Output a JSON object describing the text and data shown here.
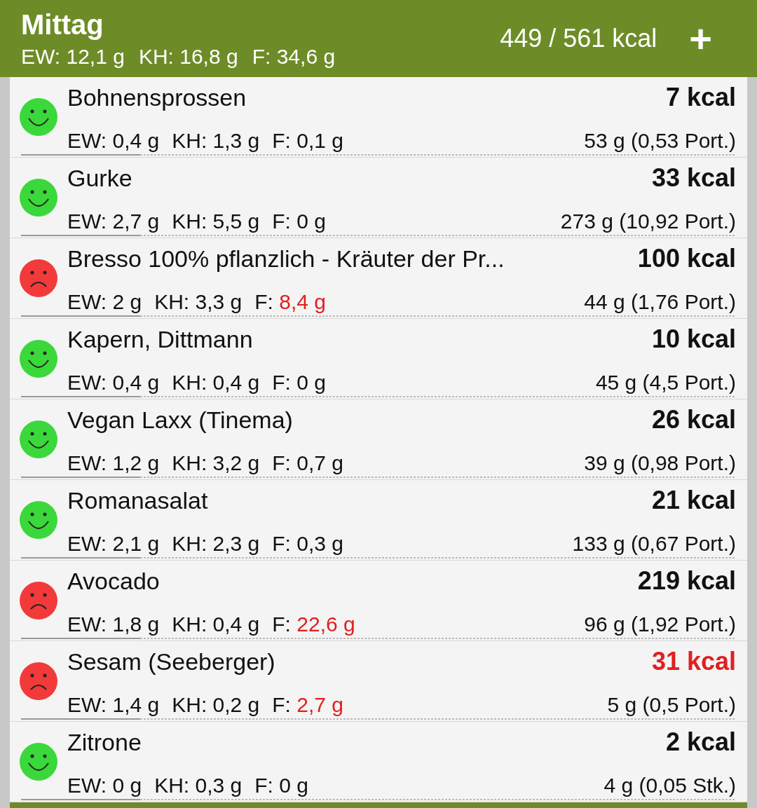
{
  "header": {
    "title": "Mittag",
    "macros": [
      {
        "label": "EW:",
        "value": "12,1 g"
      },
      {
        "label": "KH:",
        "value": "16,8 g"
      },
      {
        "label": "F:",
        "value": "34,6 g"
      }
    ],
    "total": "449 / 561 kcal",
    "add": "+"
  },
  "items": [
    {
      "name": "Bohnensprossen",
      "kind": "happy",
      "kcal": "7 kcal",
      "kcal_warning": false,
      "macros": [
        {
          "label": "EW:",
          "value": "0,4 g",
          "warning": false
        },
        {
          "label": "KH:",
          "value": "1,3 g",
          "warning": false
        },
        {
          "label": "F:",
          "value": "0,1 g",
          "warning": false
        }
      ],
      "amount": "53 g (0,53 Port.)"
    },
    {
      "name": "Gurke",
      "kind": "happy",
      "kcal": "33 kcal",
      "kcal_warning": false,
      "macros": [
        {
          "label": "EW:",
          "value": "2,7 g",
          "warning": false
        },
        {
          "label": "KH:",
          "value": "5,5 g",
          "warning": false
        },
        {
          "label": "F:",
          "value": "0 g",
          "warning": false
        }
      ],
      "amount": "273 g (10,92 Port.)"
    },
    {
      "name": "Bresso 100% pflanzlich - Kräuter der Pr...",
      "kind": "sad",
      "kcal": "100 kcal",
      "kcal_warning": false,
      "macros": [
        {
          "label": "EW:",
          "value": "2 g",
          "warning": false
        },
        {
          "label": "KH:",
          "value": "3,3 g",
          "warning": false
        },
        {
          "label": "F:",
          "value": "8,4 g",
          "warning": true
        }
      ],
      "amount": "44 g (1,76 Port.)"
    },
    {
      "name": "Kapern, Dittmann",
      "kind": "happy",
      "kcal": "10 kcal",
      "kcal_warning": false,
      "macros": [
        {
          "label": "EW:",
          "value": "0,4 g",
          "warning": false
        },
        {
          "label": "KH:",
          "value": "0,4 g",
          "warning": false
        },
        {
          "label": "F:",
          "value": "0 g",
          "warning": false
        }
      ],
      "amount": "45 g (4,5 Port.)"
    },
    {
      "name": "Vegan Laxx (Tinema)",
      "kind": "happy",
      "kcal": "26 kcal",
      "kcal_warning": false,
      "macros": [
        {
          "label": "EW:",
          "value": "1,2 g",
          "warning": false
        },
        {
          "label": "KH:",
          "value": "3,2 g",
          "warning": false
        },
        {
          "label": "F:",
          "value": "0,7 g",
          "warning": false
        }
      ],
      "amount": "39 g (0,98 Port.)"
    },
    {
      "name": "Romanasalat",
      "kind": "happy",
      "kcal": "21 kcal",
      "kcal_warning": false,
      "macros": [
        {
          "label": "EW:",
          "value": "2,1 g",
          "warning": false
        },
        {
          "label": "KH:",
          "value": "2,3 g",
          "warning": false
        },
        {
          "label": "F:",
          "value": "0,3 g",
          "warning": false
        }
      ],
      "amount": "133 g (0,67 Port.)"
    },
    {
      "name": "Avocado",
      "kind": "sad",
      "kcal": "219 kcal",
      "kcal_warning": false,
      "macros": [
        {
          "label": "EW:",
          "value": "1,8 g",
          "warning": false
        },
        {
          "label": "KH:",
          "value": "0,4 g",
          "warning": false
        },
        {
          "label": "F:",
          "value": "22,6 g",
          "warning": true
        }
      ],
      "amount": "96 g (1,92 Port.)"
    },
    {
      "name": "Sesam (Seeberger)",
      "kind": "sad",
      "kcal": "31 kcal",
      "kcal_warning": true,
      "macros": [
        {
          "label": "EW:",
          "value": "1,4 g",
          "warning": false
        },
        {
          "label": "KH:",
          "value": "0,2 g",
          "warning": false
        },
        {
          "label": "F:",
          "value": "2,7 g",
          "warning": true
        }
      ],
      "amount": "5 g (0,5 Port.)"
    },
    {
      "name": "Zitrone",
      "kind": "happy",
      "kcal": "2 kcal",
      "kcal_warning": false,
      "macros": [
        {
          "label": "EW:",
          "value": "0 g",
          "warning": false
        },
        {
          "label": "KH:",
          "value": "0,3 g",
          "warning": false
        },
        {
          "label": "F:",
          "value": "0 g",
          "warning": false
        }
      ],
      "amount": "4 g (0,05 Stk.)"
    }
  ]
}
